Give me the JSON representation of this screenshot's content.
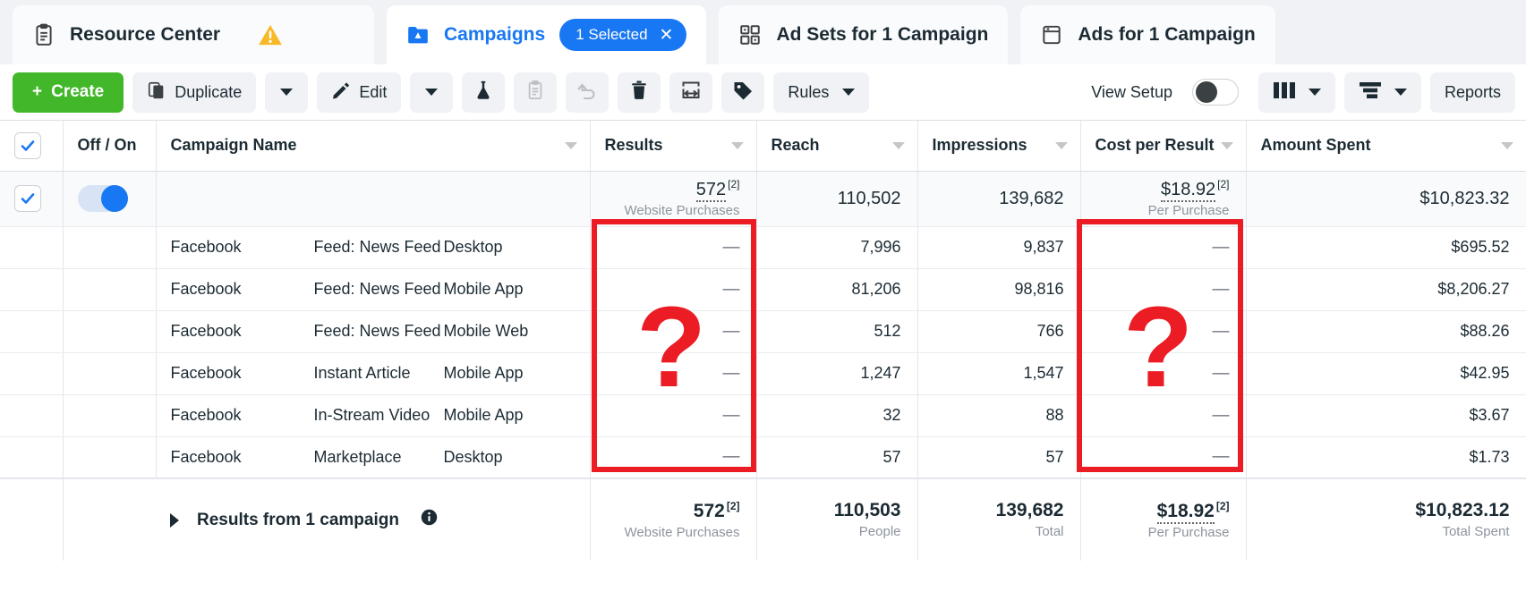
{
  "tabs": [
    {
      "label": "Resource Center",
      "icon": "clipboard-icon",
      "active": false,
      "warning": true
    },
    {
      "label": "Campaigns",
      "icon": "campaign-folder-icon",
      "active": true,
      "badge": "1 Selected"
    },
    {
      "label": "Ad Sets for 1 Campaign",
      "icon": "adsets-grid-icon",
      "active": false
    },
    {
      "label": "Ads for 1 Campaign",
      "icon": "ads-page-icon",
      "active": false
    }
  ],
  "toolbar": {
    "create_label": "Create",
    "duplicate_label": "Duplicate",
    "edit_label": "Edit",
    "rules_label": "Rules",
    "view_setup_label": "View Setup",
    "view_setup_on": false,
    "reports_label": "Reports",
    "icons": {
      "ab_test": "flask-icon",
      "clipboard": "clipboard-icon",
      "undo": "undo-arrow-icon",
      "delete": "trash-icon",
      "export": "export-icon",
      "tag": "tag-icon",
      "columns": "columns-icon",
      "breakdown": "breakdown-icon"
    }
  },
  "table": {
    "headers": {
      "off_on": "Off / On",
      "campaign_name": "Campaign Name",
      "results": "Results",
      "reach": "Reach",
      "impressions": "Impressions",
      "cost_per_result": "Cost per Result",
      "amount_spent": "Amount Spent"
    },
    "summary_row": {
      "checked": true,
      "toggle_on": true,
      "results": "572",
      "results_sup": "[2]",
      "results_sub": "Website Purchases",
      "reach": "110,502",
      "impressions": "139,682",
      "cost_per_result": "$18.92",
      "cost_per_result_sup": "[2]",
      "cost_per_result_sub": "Per Purchase",
      "amount_spent": "$10,823.32"
    },
    "rows": [
      {
        "platform": "Facebook",
        "placement": "Feed: News Feed",
        "device": "Desktop",
        "results": "—",
        "reach": "7,996",
        "impressions": "9,837",
        "cost_per_result": "—",
        "amount_spent": "$695.52"
      },
      {
        "platform": "Facebook",
        "placement": "Feed: News Feed",
        "device": "Mobile App",
        "results": "—",
        "reach": "81,206",
        "impressions": "98,816",
        "cost_per_result": "—",
        "amount_spent": "$8,206.27"
      },
      {
        "platform": "Facebook",
        "placement": "Feed: News Feed",
        "device": "Mobile Web",
        "results": "—",
        "reach": "512",
        "impressions": "766",
        "cost_per_result": "—",
        "amount_spent": "$88.26"
      },
      {
        "platform": "Facebook",
        "placement": "Instant Article",
        "device": "Mobile App",
        "results": "—",
        "reach": "1,247",
        "impressions": "1,547",
        "cost_per_result": "—",
        "amount_spent": "$42.95"
      },
      {
        "platform": "Facebook",
        "placement": "In-Stream Video",
        "device": "Mobile App",
        "results": "—",
        "reach": "32",
        "impressions": "88",
        "cost_per_result": "—",
        "amount_spent": "$3.67"
      },
      {
        "platform": "Facebook",
        "placement": "Marketplace",
        "device": "Desktop",
        "results": "—",
        "reach": "57",
        "impressions": "57",
        "cost_per_result": "—",
        "amount_spent": "$1.73"
      }
    ],
    "totals": {
      "label": "Results from 1 campaign",
      "results": "572",
      "results_sup": "[2]",
      "results_sub": "Website Purchases",
      "reach": "110,503",
      "reach_sub": "People",
      "impressions": "139,682",
      "impressions_sub": "Total",
      "cost_per_result": "$18.92",
      "cost_per_result_sup": "[2]",
      "cost_per_result_sub": "Per Purchase",
      "amount_spent": "$10,823.12",
      "amount_spent_sub": "Total Spent"
    }
  },
  "annotations": {
    "question_mark": "?",
    "accent_red": "#ec1c24"
  }
}
